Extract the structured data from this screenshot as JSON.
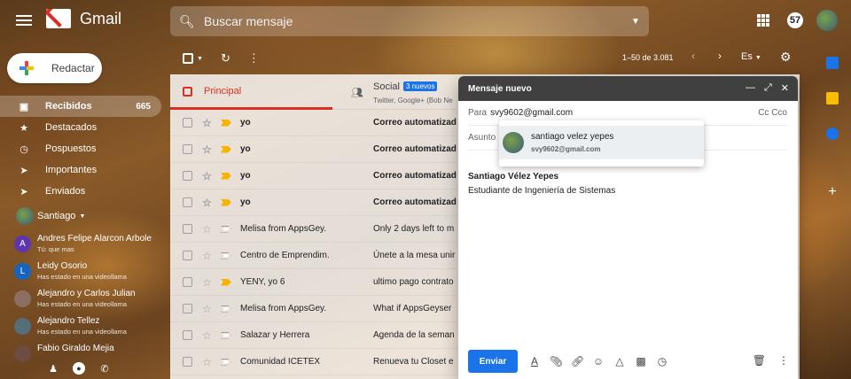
{
  "header": {
    "logo": "Gmail",
    "search_placeholder": "Buscar mensaje",
    "notifications": "57"
  },
  "sidebar": {
    "compose": "Redactar",
    "items": [
      {
        "label": "Recibidos",
        "count": "665",
        "icon": "inbox-icon"
      },
      {
        "label": "Destacados",
        "count": "",
        "icon": "star-icon"
      },
      {
        "label": "Pospuestos",
        "count": "",
        "icon": "clock-icon"
      },
      {
        "label": "Importantes",
        "count": "",
        "icon": "important-icon"
      },
      {
        "label": "Enviados",
        "count": "",
        "icon": "send-icon"
      }
    ],
    "chat_user": "Santiago",
    "contacts": [
      {
        "initial": "A",
        "name": "Andres Felipe Alarcon Arbole",
        "status": "Tú: que mas",
        "color": "#5e35b1"
      },
      {
        "initial": "L",
        "name": "Leidy Osorio",
        "status": "Has estado en una videollama",
        "color": "#1565c0"
      },
      {
        "initial": "",
        "name": "Alejandro y Carlos Julian",
        "status": "Has estado en una videollama",
        "color": "#8d6e63"
      },
      {
        "initial": "",
        "name": "Alejandro Tellez",
        "status": "Has estado en una videollama",
        "color": "#546e7a"
      },
      {
        "initial": "",
        "name": "Fabio Giraldo Mejia",
        "status": "",
        "color": "#6d4c41"
      }
    ]
  },
  "toolbar": {
    "pager": "1–50 de 3.081",
    "lang": "Es"
  },
  "tabs": {
    "principal": "Principal",
    "social": "Social",
    "social_badge": "3 nuevos",
    "social_sub": "Twitter, Google+ (Bob Ne"
  },
  "emails": [
    {
      "from": "yo",
      "subject": "Correo automatizad",
      "unread": true,
      "important": true
    },
    {
      "from": "yo",
      "subject": "Correo automatizad",
      "unread": true,
      "important": true
    },
    {
      "from": "yo",
      "subject": "Correo automatizad",
      "unread": true,
      "important": true
    },
    {
      "from": "yo",
      "subject": "Correo automatizad",
      "unread": true,
      "important": true
    },
    {
      "from": "Melisa from AppsGey.",
      "subject": "Only 2 days left to m",
      "unread": false,
      "important": false
    },
    {
      "from": "Centro de Emprendim.",
      "subject": "Únete a la mesa unir",
      "unread": false,
      "important": false
    },
    {
      "from": "YENY, yo 6",
      "subject": "ultimo pago contrato",
      "unread": false,
      "important": true
    },
    {
      "from": "Melisa from AppsGey.",
      "subject": "What if AppsGeyser",
      "unread": false,
      "important": false
    },
    {
      "from": "Salazar y Herrera",
      "subject": "Agenda de la seman",
      "unread": false,
      "important": false
    },
    {
      "from": "Comunidad ICETEX",
      "subject": "Renueva tu Closet e",
      "unread": false,
      "important": false
    }
  ],
  "compose": {
    "title": "Mensaje nuevo",
    "to_label": "Para",
    "to_value": "svy9602@gmail.com",
    "cc": "Cc Cco",
    "subject_placeholder": "Asunto",
    "suggestion_name": "santiago velez yepes",
    "suggestion_email": "svy9602@gmail.com",
    "signature_name": "Santiago Vélez Yepes",
    "signature_title": "Estudiante de Ingeniería de Sistemas",
    "send": "Enviar"
  }
}
